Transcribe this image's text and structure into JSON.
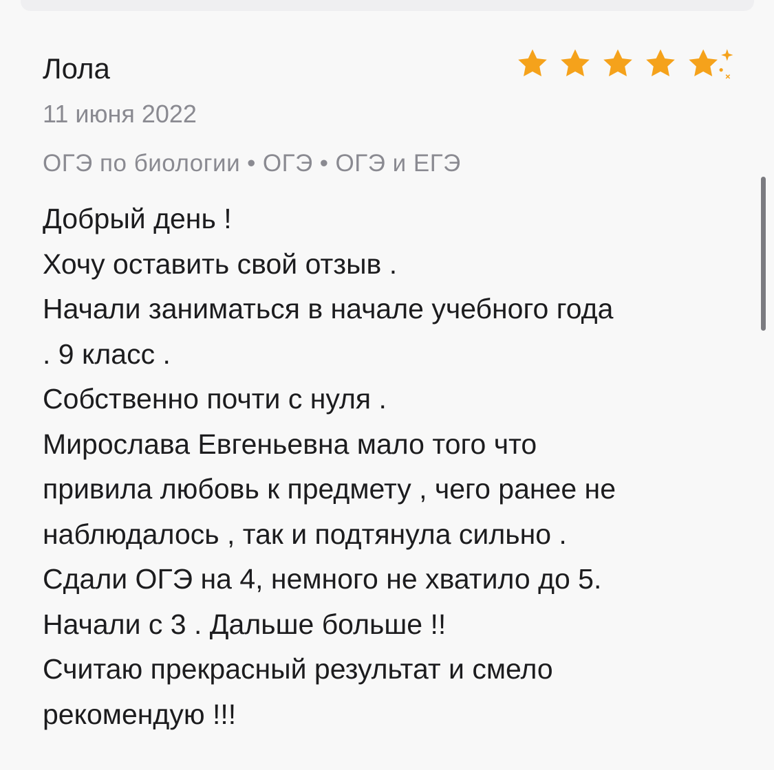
{
  "review": {
    "author": "Лола",
    "date": "11 июня 2022",
    "rating": 4.5,
    "tags": [
      "ОГЭ по биологии",
      "ОГЭ",
      "ОГЭ и ЕГЭ"
    ],
    "tag_separator": "•",
    "lines": [
      "Добрый день !",
      "Хочу оставить свой отзыв .",
      "Начали заниматься в начале учебного года",
      ". 9 класс .",
      "Собственно почти с нуля .",
      "Мирослава Евгеньевна мало того что",
      "привила любовь к предмету , чего ранее не",
      "наблюдалось , так и подтянула сильно .",
      "Сдали ОГЭ на 4, немного не хватило до 5.",
      "Начали с 3 . Дальше больше !!",
      "Считаю прекрасный результат и смело",
      "рекомендую !!!"
    ]
  },
  "colors": {
    "star": "#f5a21b",
    "star_empty": "#f3c35a",
    "text": "#1c1c1e",
    "muted": "#8a8a91",
    "background": "#f8f8f8"
  },
  "icons": {
    "star": "star-icon",
    "sparkle": "sparkle-icon"
  }
}
